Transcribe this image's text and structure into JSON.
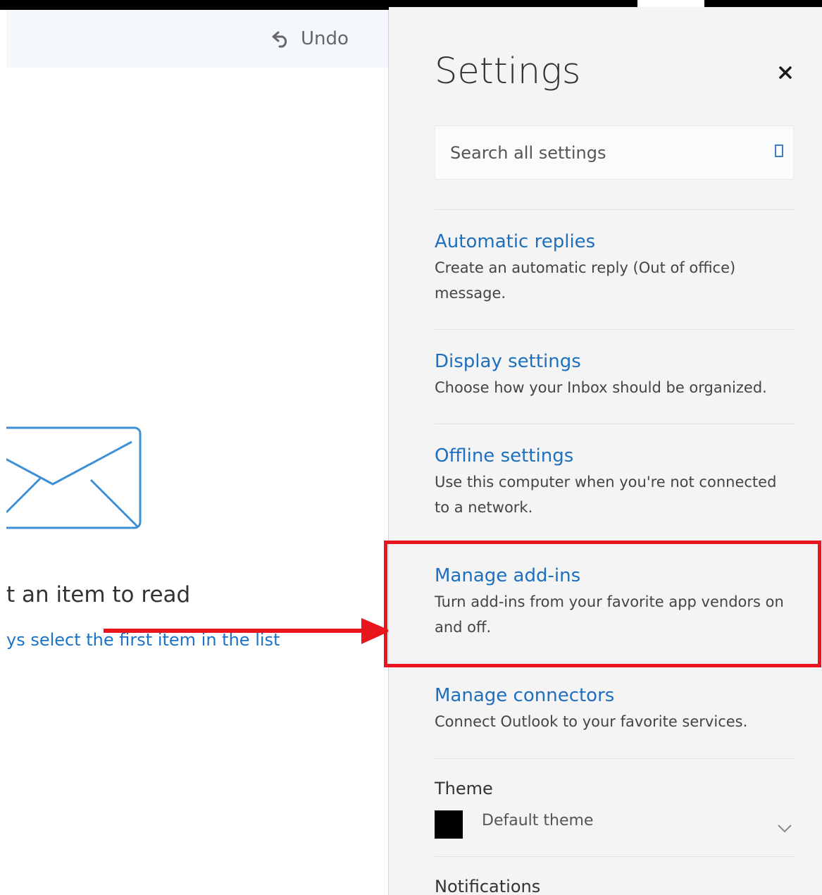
{
  "reading_pane": {
    "toolbar": {
      "undo_label": "Undo"
    },
    "empty_state": {
      "title": "t an item to read",
      "link": "ys select the first item in the list"
    }
  },
  "settings": {
    "title": "Settings",
    "search": {
      "placeholder": "Search all settings"
    },
    "items": [
      {
        "title": "Automatic replies",
        "description": "Create an automatic reply (Out of office) message."
      },
      {
        "title": "Display settings",
        "description": "Choose how your Inbox should be organized."
      },
      {
        "title": "Offline settings",
        "description": "Use this computer when you're not connected to a network."
      },
      {
        "title": "Manage add-ins",
        "description": "Turn add-ins from your favorite app vendors on and off."
      },
      {
        "title": "Manage connectors",
        "description": "Connect Outlook to your favorite services."
      }
    ],
    "theme": {
      "label": "Theme",
      "value": "Default theme",
      "swatch_color": "#000000"
    },
    "notifications": {
      "label": "Notifications"
    }
  },
  "colors": {
    "accent": "#1f6fbf",
    "highlight": "#e8151d",
    "panel_background": "#f4f4f4"
  },
  "icons": {
    "undo": "undo-icon",
    "close": "close-icon",
    "search": "search-icon",
    "envelope": "envelope-icon",
    "chevron": "chevron-down-icon"
  }
}
